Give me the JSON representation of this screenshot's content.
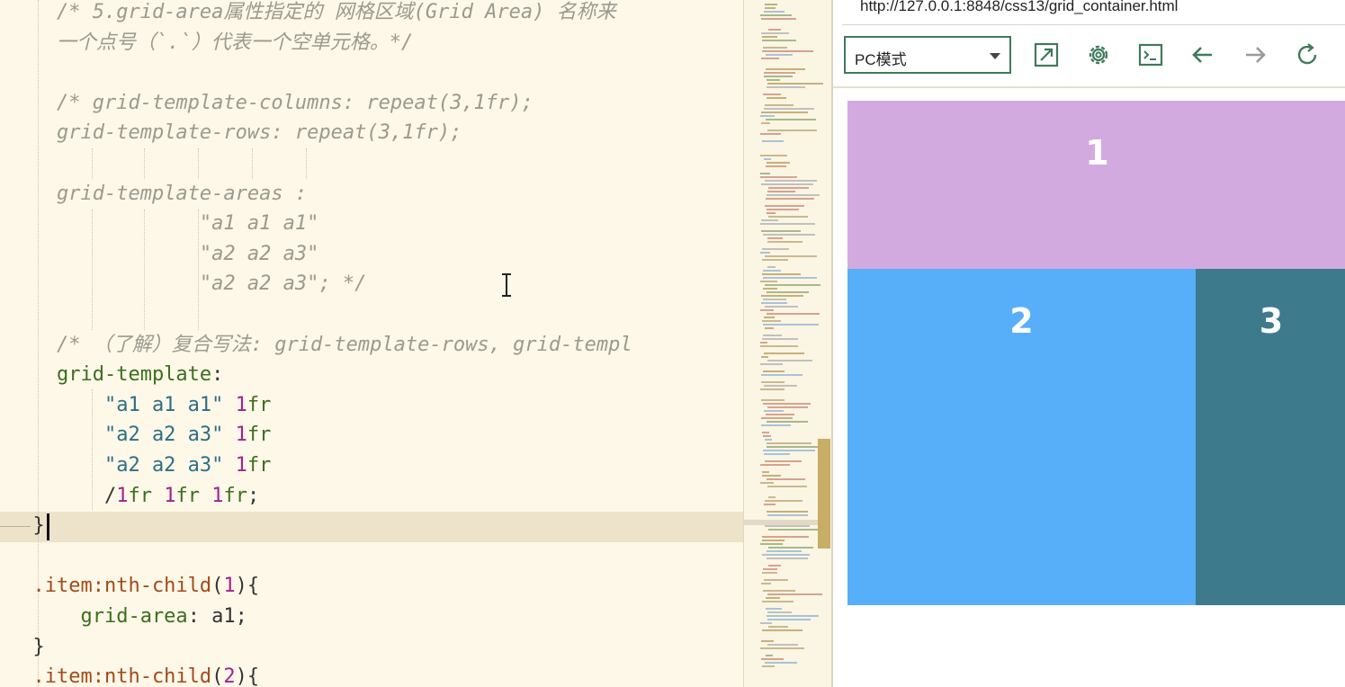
{
  "editor": {
    "lines": [
      [
        {
          "c": "cm",
          "t": "    /* 5.grid-area属性指定的 网格区域(Grid Area) 名称来"
        }
      ],
      [
        {
          "c": "cm",
          "t": "    一个点号（`.`）代表一个空单元格。*/"
        }
      ],
      [],
      [
        {
          "c": "cm",
          "t": "    /* grid-template-columns: repeat(3,1fr);"
        }
      ],
      [
        {
          "c": "cm",
          "t": "    grid-template-rows: repeat(3,1fr);"
        }
      ],
      [],
      [
        {
          "c": "cm",
          "t": "    grid-template-areas :"
        }
      ],
      [
        {
          "c": "cm",
          "t": "                \"a1 a1 a1\""
        }
      ],
      [
        {
          "c": "cm",
          "t": "                \"a2 a2 a3\""
        }
      ],
      [
        {
          "c": "cm",
          "t": "                \"a2 a2 a3\"; */"
        }
      ],
      [],
      [
        {
          "c": "cm",
          "t": "    /* （了解）复合写法: grid-template-rows, grid-templ"
        }
      ],
      [
        {
          "c": "prop",
          "t": "    grid-template"
        },
        {
          "c": "plain",
          "t": ":"
        }
      ],
      [
        {
          "c": "str",
          "t": "        \"a1 a1 a1\""
        },
        {
          "c": "plain",
          "t": " "
        },
        {
          "c": "num",
          "t": "1"
        },
        {
          "c": "prop",
          "t": "fr"
        }
      ],
      [
        {
          "c": "str",
          "t": "        \"a2 a2 a3\""
        },
        {
          "c": "plain",
          "t": " "
        },
        {
          "c": "num",
          "t": "1"
        },
        {
          "c": "prop",
          "t": "fr"
        }
      ],
      [
        {
          "c": "str",
          "t": "        \"a2 a2 a3\""
        },
        {
          "c": "plain",
          "t": " "
        },
        {
          "c": "num",
          "t": "1"
        },
        {
          "c": "prop",
          "t": "fr"
        }
      ],
      [
        {
          "c": "plain",
          "t": "        /"
        },
        {
          "c": "num",
          "t": "1"
        },
        {
          "c": "prop",
          "t": "fr"
        },
        {
          "c": "plain",
          "t": " "
        },
        {
          "c": "num",
          "t": "1"
        },
        {
          "c": "prop",
          "t": "fr"
        },
        {
          "c": "plain",
          "t": " "
        },
        {
          "c": "num",
          "t": "1"
        },
        {
          "c": "prop",
          "t": "fr"
        },
        {
          "c": "plain",
          "t": ";"
        }
      ],
      [
        {
          "c": "plain",
          "t": "  }"
        }
      ],
      [],
      [
        {
          "c": "sel",
          "t": "  .item:nth-child"
        },
        {
          "c": "plain",
          "t": "("
        },
        {
          "c": "num",
          "t": "1"
        },
        {
          "c": "plain",
          "t": "){"
        }
      ],
      [
        {
          "c": "prop",
          "t": "      grid-area"
        },
        {
          "c": "plain",
          "t": ": a1;"
        }
      ],
      [
        {
          "c": "plain",
          "t": "  }"
        }
      ],
      [
        {
          "c": "sel",
          "t": "  .item:nth-child"
        },
        {
          "c": "plain",
          "t": "("
        },
        {
          "c": "num",
          "t": "2"
        },
        {
          "c": "plain",
          "t": "){"
        }
      ]
    ]
  },
  "browser": {
    "url": "http://127.0.0.1:8848/css13/grid_container.html",
    "mode_select": {
      "value": "PC模式"
    },
    "toolbar_icons": [
      "resize-icon",
      "settings-gear-icon",
      "terminal-icon",
      "back-arrow-icon",
      "forward-arrow-icon",
      "refresh-icon"
    ],
    "grid_items": [
      {
        "label": "1",
        "color": "#d3aae0"
      },
      {
        "label": "2",
        "color": "#57affa"
      },
      {
        "label": "3",
        "color": "#3c7a8c"
      }
    ]
  },
  "colors": {
    "editor_bg": "#fdf8e8",
    "accent_green": "#3f7a5a",
    "scrollbar": "#c8ad66"
  }
}
